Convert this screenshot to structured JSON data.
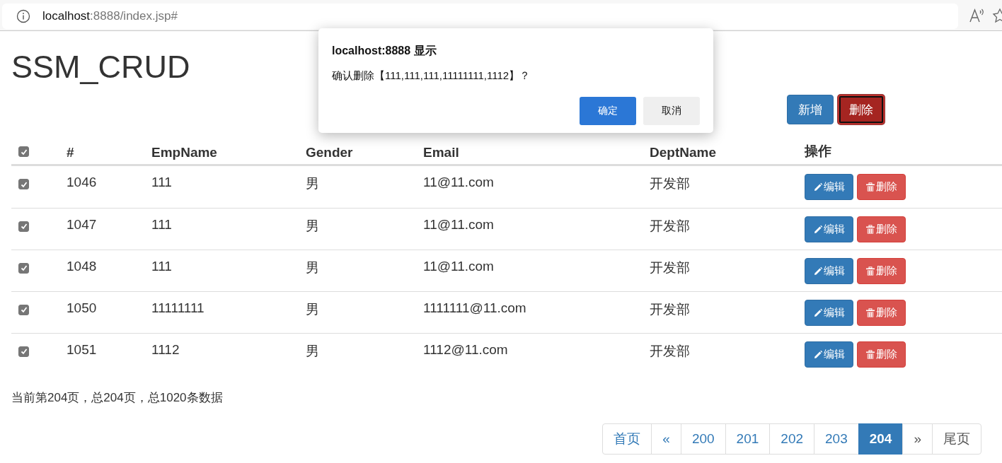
{
  "browser": {
    "url_host": "localhost",
    "url_path": ":8888/index.jsp#"
  },
  "page_title": "SSM_CRUD",
  "toolbar_buttons": [
    {
      "kind": "add",
      "label": "新增",
      "focused": false
    },
    {
      "kind": "delete",
      "label": "删除",
      "focused": true
    }
  ],
  "table": {
    "select_all": {
      "checked": true
    },
    "columns": [
      "#",
      "EmpName",
      "Gender",
      "Email",
      "DeptName",
      "操作"
    ],
    "rows": [
      {
        "checked": true,
        "cells": [
          "1046",
          "111",
          "男",
          "11@11.com",
          "开发部"
        ],
        "actions": [
          {
            "kind": "edit",
            "label": "编辑"
          },
          {
            "kind": "delete",
            "label": "删除"
          }
        ]
      },
      {
        "checked": true,
        "cells": [
          "1047",
          "111",
          "男",
          "11@11.com",
          "开发部"
        ],
        "actions": [
          {
            "kind": "edit",
            "label": "编辑"
          },
          {
            "kind": "delete",
            "label": "删除"
          }
        ]
      },
      {
        "checked": true,
        "cells": [
          "1048",
          "111",
          "男",
          "11@11.com",
          "开发部"
        ],
        "actions": [
          {
            "kind": "edit",
            "label": "编辑"
          },
          {
            "kind": "delete",
            "label": "删除"
          }
        ]
      },
      {
        "checked": true,
        "cells": [
          "1050",
          "11111111",
          "男",
          "1111111@11.com",
          "开发部"
        ],
        "actions": [
          {
            "kind": "edit",
            "label": "编辑"
          },
          {
            "kind": "delete",
            "label": "删除"
          }
        ]
      },
      {
        "checked": true,
        "cells": [
          "1051",
          "1112",
          "男",
          "1112@11.com",
          "开发部"
        ],
        "actions": [
          {
            "kind": "edit",
            "label": "编辑"
          },
          {
            "kind": "delete",
            "label": "删除"
          }
        ]
      }
    ]
  },
  "page_info": "当前第204页，总204页，总1020条数据",
  "pagination": [
    {
      "label": "首页",
      "selected": false,
      "disabled": false
    },
    {
      "label": "«",
      "selected": false,
      "disabled": false
    },
    {
      "label": "200",
      "selected": false,
      "disabled": false
    },
    {
      "label": "201",
      "selected": false,
      "disabled": false
    },
    {
      "label": "202",
      "selected": false,
      "disabled": false
    },
    {
      "label": "203",
      "selected": false,
      "disabled": false
    },
    {
      "label": "204",
      "selected": true,
      "disabled": false
    },
    {
      "label": "»",
      "selected": false,
      "disabled": true
    },
    {
      "label": "尾页",
      "selected": false,
      "disabled": true
    }
  ],
  "dialog": {
    "title": "localhost:8888 显示",
    "message": "确认删除【111,111,111,11111111,1112】？",
    "buttons": [
      {
        "label": "确定",
        "primary": true
      },
      {
        "label": "取消",
        "primary": false
      }
    ]
  }
}
